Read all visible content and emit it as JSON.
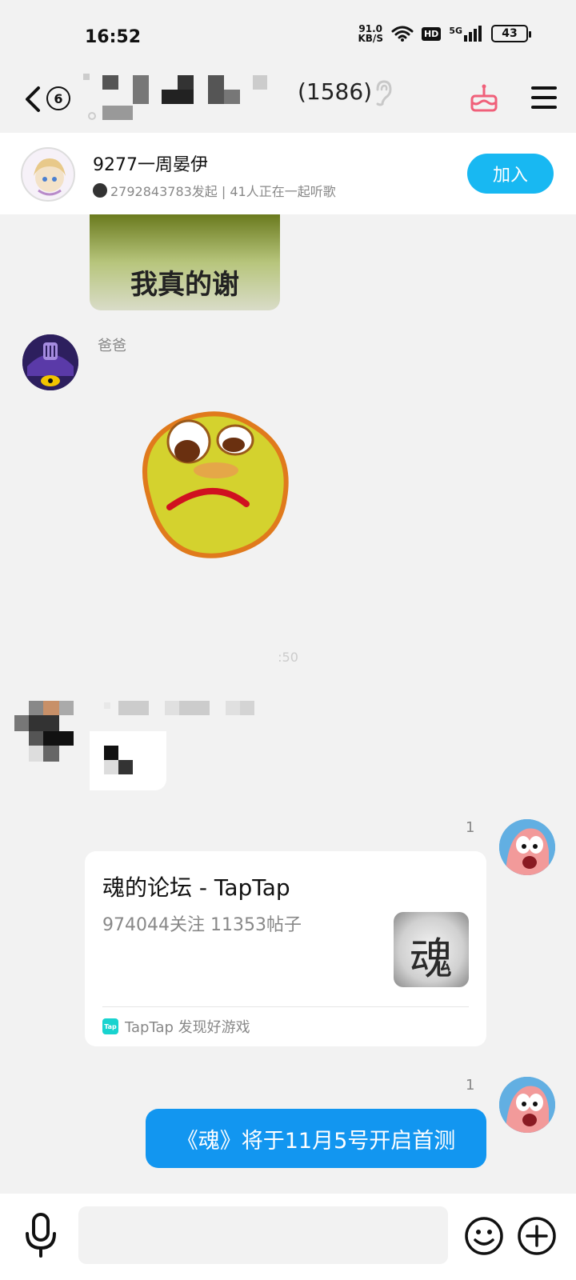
{
  "status_bar": {
    "time": "16:52",
    "net_speed_value": "91.0",
    "net_speed_unit": "KB/S",
    "hd_label": "HD",
    "signal_label": "5G",
    "battery": "43"
  },
  "header": {
    "unread_count": "6",
    "member_count": "(1586)",
    "icons": [
      "back-arrow-icon",
      "ear-icon",
      "cake-icon",
      "menu-icon"
    ]
  },
  "listen_together": {
    "title": "9277一周晏伊",
    "subtitle": "2792843783发起 | 41人正在一起听歌",
    "join_label": "加入"
  },
  "messages": {
    "sticker_caption": "我真的谢",
    "sender_name_1": "爸爸",
    "timestamp": ":50",
    "card_read_count": "1",
    "card": {
      "title": "魂的论坛 - TapTap",
      "description": "974044关注 11353帖子",
      "thumb_glyph": "魂",
      "footer_logo": "Tap",
      "footer_text": "TapTap 发现好游戏"
    },
    "text_read_count": "1",
    "text_message": "《魂》将于11月5号开启首测"
  },
  "input_bar": {
    "placeholder": "",
    "icons": [
      "microphone-icon",
      "emoji-icon",
      "plus-icon"
    ]
  },
  "colors": {
    "accent_blue": "#1296f0",
    "join_blue": "#18b8f2",
    "cake_pink": "#f0607a"
  }
}
